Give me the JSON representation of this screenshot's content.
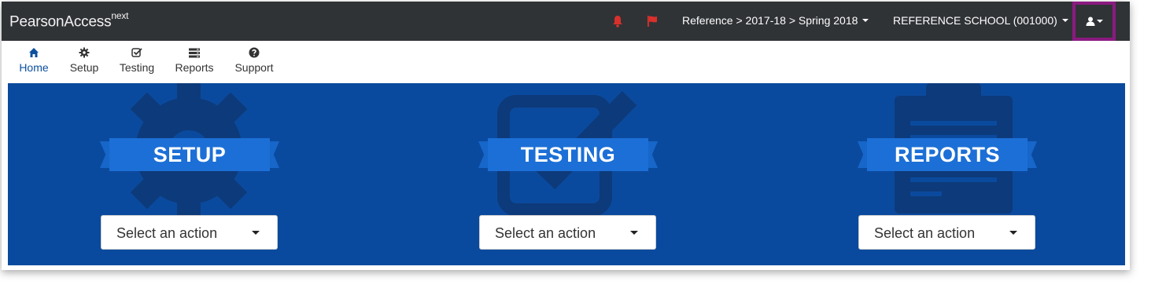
{
  "navbar": {
    "brand": "PearsonAccess",
    "brand_sup": "next",
    "context": "Reference > 2017-18 > Spring 2018",
    "organization": "REFERENCE SCHOOL (001000)",
    "alert_color": "#d9302c"
  },
  "subnav": {
    "items": [
      {
        "label": "Home",
        "icon": "home-icon"
      },
      {
        "label": "Setup",
        "icon": "gear-icon"
      },
      {
        "label": "Testing",
        "icon": "checkbox-icon"
      },
      {
        "label": "Reports",
        "icon": "reports-icon"
      },
      {
        "label": "Support",
        "icon": "question-icon"
      }
    ],
    "active": "Home"
  },
  "hero": {
    "background": "#0a4a9e",
    "panels": [
      {
        "title": "SETUP",
        "action": "Select an action",
        "icon": "gear-icon"
      },
      {
        "title": "TESTING",
        "action": "Select an action",
        "icon": "checkbox-icon"
      },
      {
        "title": "REPORTS",
        "action": "Select an action",
        "icon": "clipboard-icon"
      }
    ]
  }
}
